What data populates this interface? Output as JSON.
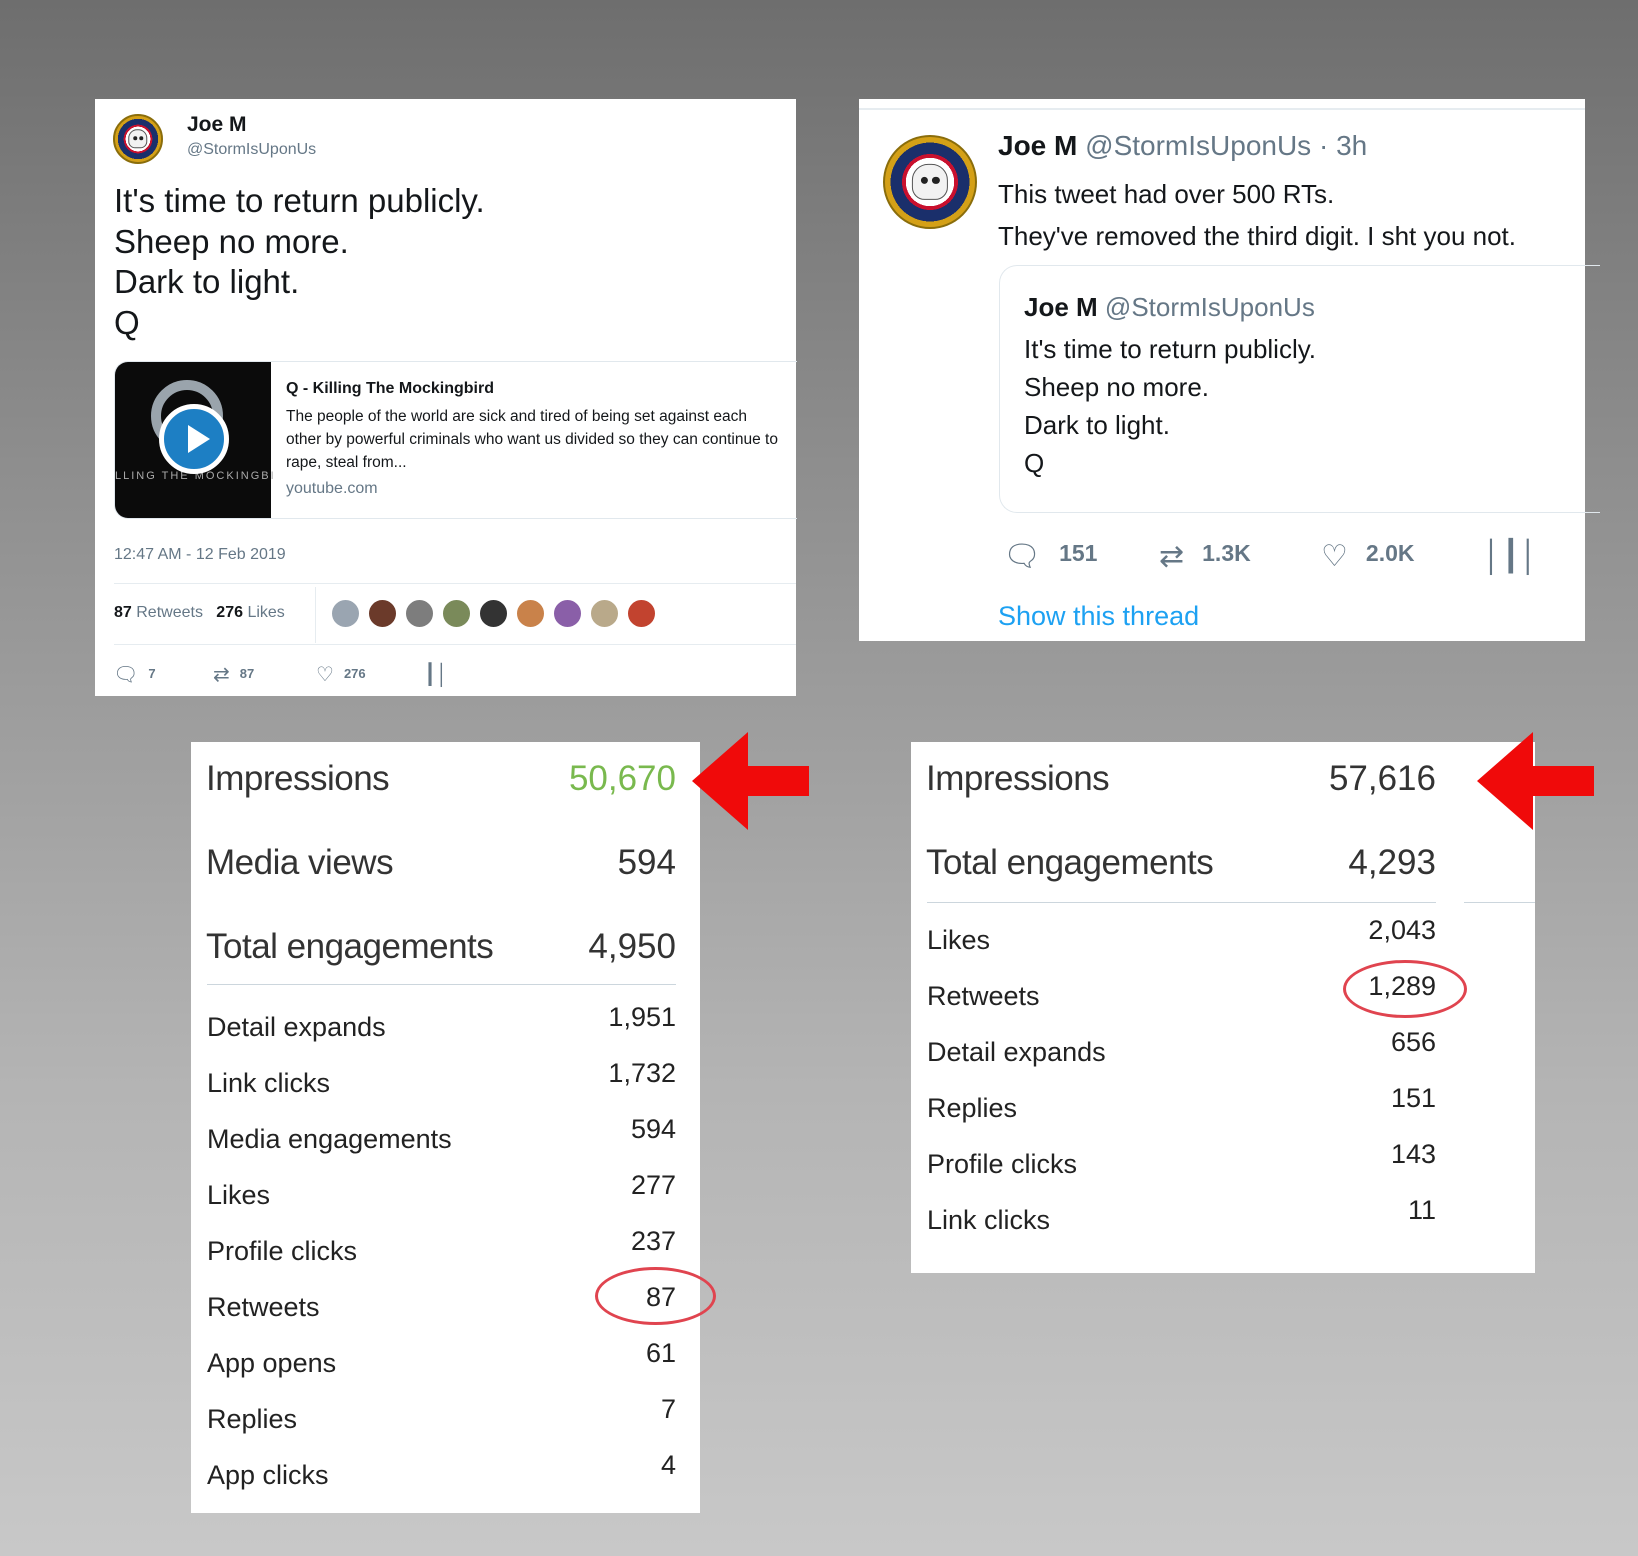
{
  "tweet1": {
    "name": "Joe M",
    "handle": "@StormIsUponUs",
    "text_lines": [
      "It's time to return publicly.",
      "Sheep no more.",
      "Dark to light.",
      "Q"
    ],
    "link_card": {
      "title": "Q - Killing The Mockingbird",
      "description": "The people of the world are sick and tired of being set against each other by powerful criminals who want us divided so they can continue to rape, steal from...",
      "domain": "youtube.com",
      "thumbnail_text": "LLING THE MOCKINGBI"
    },
    "timestamp": "12:47 AM - 12 Feb 2019",
    "retweets_count": "87",
    "retweets_label": "Retweets",
    "likes_count": "276",
    "likes_label": "Likes",
    "liker_avatar_colors": [
      "#9aa5b1",
      "#6b3a2a",
      "#7d7d7d",
      "#7a8a5a",
      "#333333",
      "#c9824a",
      "#8a5fa8",
      "#b9a98a",
      "#c2432f"
    ],
    "actions": {
      "replies": "7",
      "retweets": "87",
      "likes": "276"
    }
  },
  "tweet2": {
    "name": "Joe M",
    "handle": "@StormIsUponUs",
    "age": "· 3h",
    "text_lines": [
      "This tweet had over 500 RTs.",
      "They've removed the third digit. I sht you not."
    ],
    "quoted": {
      "name": "Joe M",
      "handle": "@StormIsUponUs",
      "text_lines": [
        "It's time to return publicly.",
        "Sheep no more.",
        "Dark to light.",
        "Q"
      ]
    },
    "actions": {
      "replies": "151",
      "retweets": "1.3K",
      "likes": "2.0K"
    },
    "show_thread": "Show this thread"
  },
  "analytics1": {
    "impressions_label": "Impressions",
    "impressions_value": "50,670",
    "impressions_color": "#79b94e",
    "media_views_label": "Media views",
    "media_views_value": "594",
    "total_engagements_label": "Total engagements",
    "total_engagements_value": "4,950",
    "rows": [
      {
        "label": "Detail expands",
        "value": "1,951"
      },
      {
        "label": "Link clicks",
        "value": "1,732"
      },
      {
        "label": "Media engagements",
        "value": "594"
      },
      {
        "label": "Likes",
        "value": "277"
      },
      {
        "label": "Profile clicks",
        "value": "237"
      },
      {
        "label": "Retweets",
        "value": "87"
      },
      {
        "label": "App opens",
        "value": "61"
      },
      {
        "label": "Replies",
        "value": "7"
      },
      {
        "label": "App clicks",
        "value": "4"
      }
    ]
  },
  "analytics2": {
    "impressions_label": "Impressions",
    "impressions_value": "57,616",
    "total_engagements_label": "Total engagements",
    "total_engagements_value": "4,293",
    "rows": [
      {
        "label": "Likes",
        "value": "2,043"
      },
      {
        "label": "Retweets",
        "value": "1,289"
      },
      {
        "label": "Detail expands",
        "value": "656"
      },
      {
        "label": "Replies",
        "value": "151"
      },
      {
        "label": "Profile clicks",
        "value": "143"
      },
      {
        "label": "Link clicks",
        "value": "11"
      }
    ]
  },
  "colors": {
    "arrow": "#f00a0a",
    "circle": "#e0444f",
    "link_blue": "#1da1f2"
  }
}
